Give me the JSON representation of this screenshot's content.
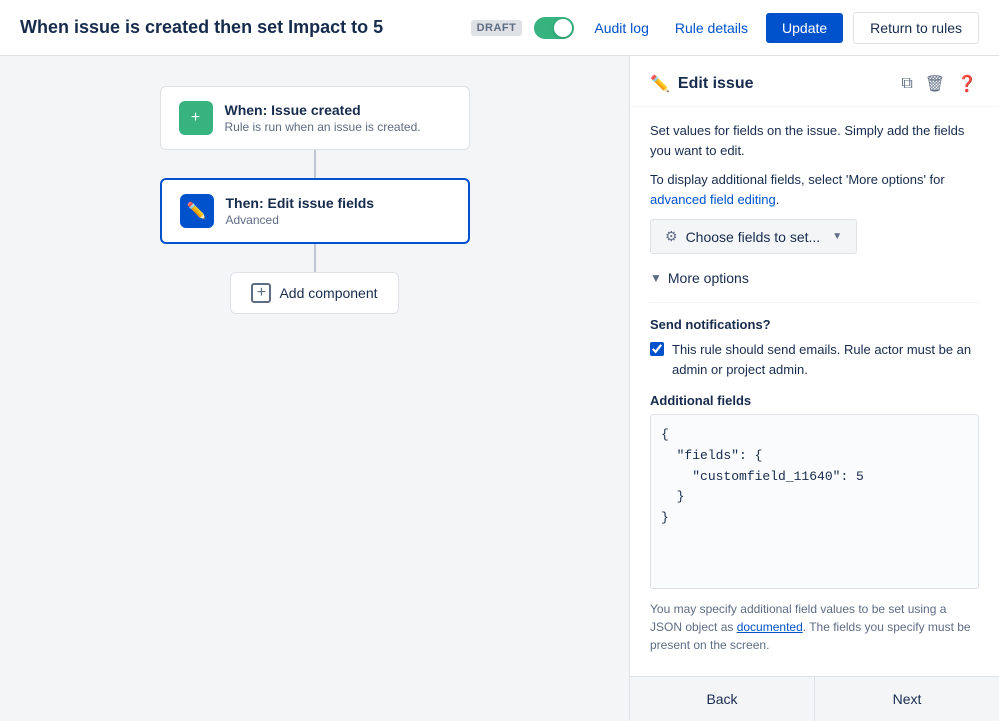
{
  "header": {
    "title": "When issue is created then set Impact to 5",
    "draft_label": "DRAFT",
    "audit_log_label": "Audit log",
    "rule_details_label": "Rule details",
    "update_label": "Update",
    "return_label": "Return to rules"
  },
  "workflow": {
    "node1": {
      "title": "When: Issue created",
      "subtitle": "Rule is run when an issue is created."
    },
    "node2": {
      "title": "Then: Edit issue fields",
      "subtitle": "Advanced"
    },
    "add_component_label": "Add component"
  },
  "panel": {
    "title": "Edit issue",
    "description1": "Set values for fields on the issue. Simply add the fields you want to edit.",
    "description2_prefix": "To display additional fields, select 'More options' for ",
    "description2_link": "advanced field editing",
    "description2_suffix": ".",
    "choose_fields_label": "Choose fields to set...",
    "more_options_label": "More options",
    "send_notifications_label": "Send notifications?",
    "checkbox_label": "This rule should send emails. Rule actor must be an admin or project admin.",
    "additional_fields_label": "Additional fields",
    "json_value": "{\n  \"fields\": {\n    \"customfield_11640\": 5\n  }\n}",
    "footer_note_prefix": "You may specify additional field values to be set using a JSON object as ",
    "footer_note_link": "documented",
    "footer_note_suffix": ". The fields you specify must be present on the screen.",
    "back_label": "Back",
    "next_label": "Next"
  }
}
